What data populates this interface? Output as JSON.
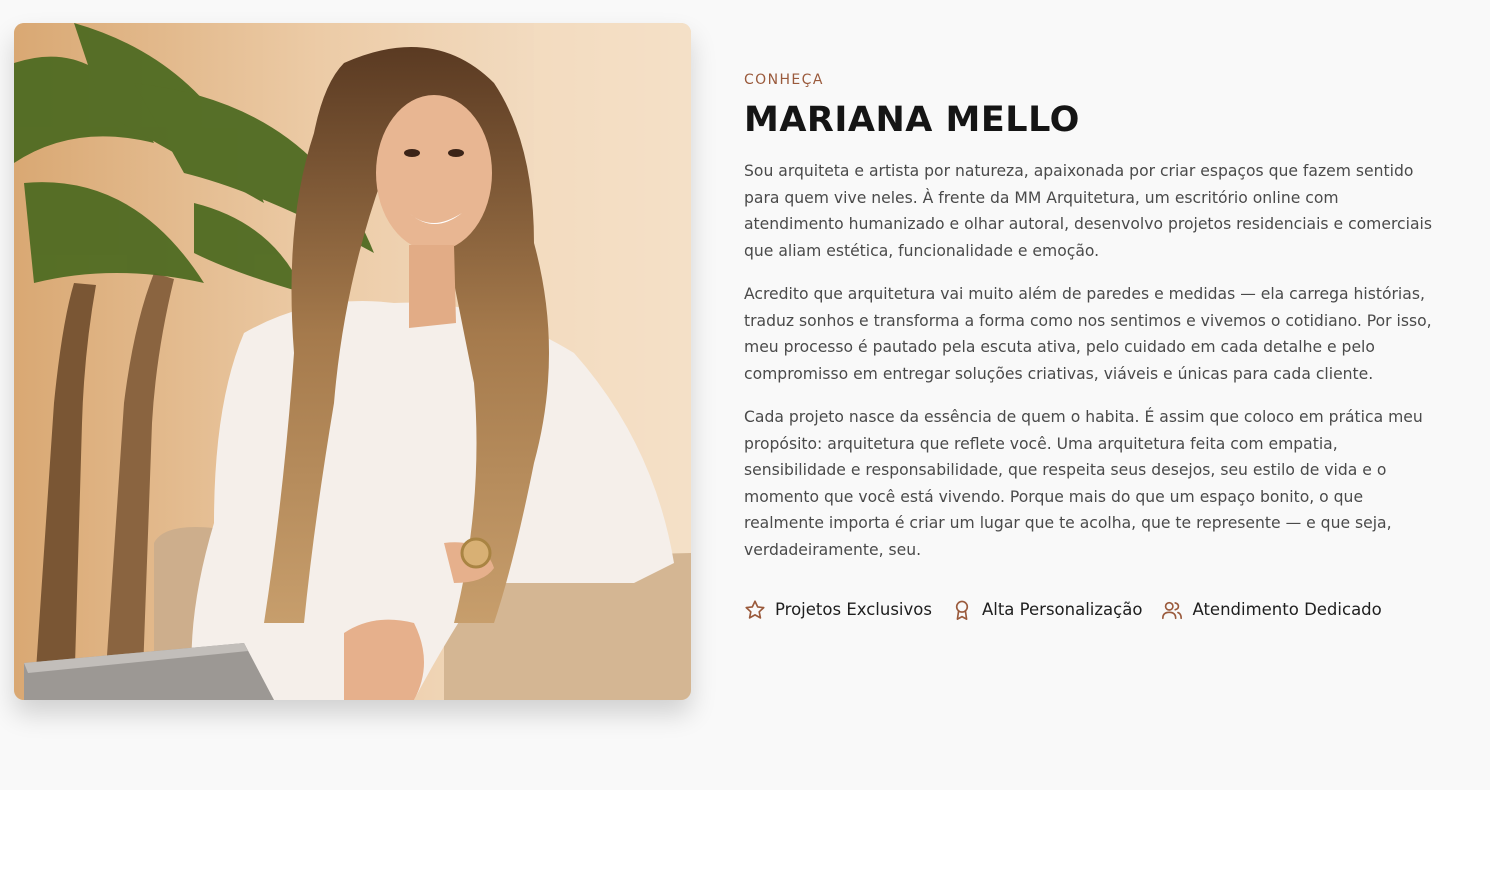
{
  "about": {
    "eyebrow": "CONHEÇA",
    "name": "MARIANA MELLO",
    "paragraphs": [
      "Sou arquiteta e artista por natureza, apaixonada por criar espaços que fazem sentido para quem vive neles. À frente da MM Arquitetura, um escritório online com atendimento humanizado e olhar autoral, desenvolvo projetos residenciais e comerciais que aliam estética, funcionalidade e emoção.",
      "Acredito que arquitetura vai muito além de paredes e medidas — ela carrega histórias, traduz sonhos e transforma a forma como nos sentimos e vivemos o cotidiano. Por isso, meu processo é pautado pela escuta ativa, pelo cuidado em cada detalhe e pelo compromisso em entregar soluções criativas, viáveis e únicas para cada cliente.",
      "Cada projeto nasce da essência de quem o habita. É assim que coloco em prática meu propósito: arquitetura que reflete você. Uma arquitetura feita com empatia, sensibilidade e responsabilidade, que respeita seus desejos, seu estilo de vida e o momento que você está vivendo. Porque mais do que um espaço bonito, o que realmente importa é criar um lugar que te acolha, que te represente — e que seja, verdadeiramente, seu."
    ],
    "features": [
      {
        "icon": "star-icon",
        "label": "Projetos Exclusivos"
      },
      {
        "icon": "award-icon",
        "label": "Alta Personalização"
      },
      {
        "icon": "users-icon",
        "label": "Atendimento Dedicado"
      }
    ],
    "accent_color": "#9a5a3c",
    "background_color": "#f9f9f9"
  }
}
